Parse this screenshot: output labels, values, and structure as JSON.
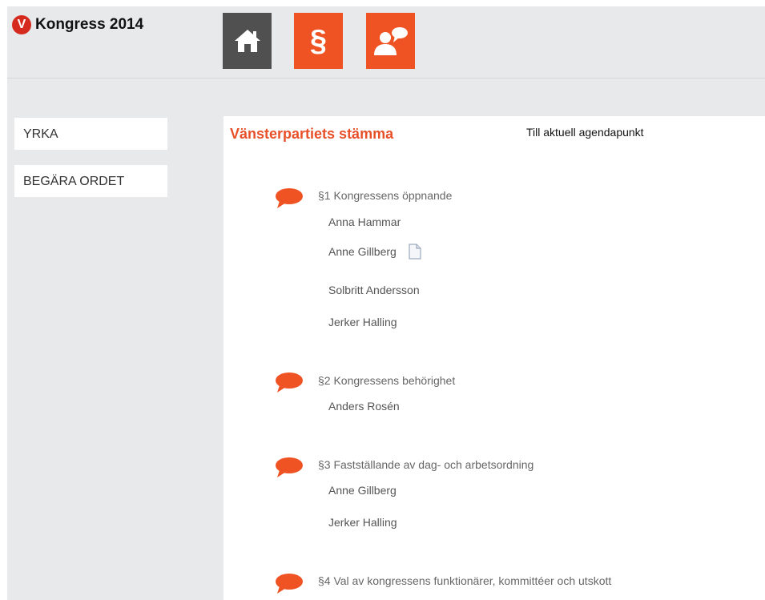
{
  "header": {
    "logo_letter": "V",
    "logo_text": "Kongress 2014",
    "nav": [
      {
        "name": "home-icon"
      },
      {
        "label": "§"
      },
      {
        "name": "speaker-bubble-icon"
      }
    ]
  },
  "sidebar": {
    "items": [
      {
        "label": "YRKA"
      },
      {
        "label": "BEGÄRA ORDET"
      }
    ]
  },
  "main": {
    "title": "Vänsterpartiets stämma",
    "aktuell_link": "Till aktuell agendapunkt",
    "agenda": [
      {
        "title": "§1 Kongressens öppnande",
        "speakers": [
          "Anna Hammar",
          "Anne Gillberg",
          "Solbritt Andersson",
          "Jerker Halling"
        ]
      },
      {
        "title": "§2 Kongressens behörighet",
        "speakers": [
          "Anders Rosén"
        ]
      },
      {
        "title": "§3 Fastställande av dag- och arbetsordning",
        "speakers": [
          "Anne Gillberg",
          "Jerker Halling"
        ]
      },
      {
        "title": "§4 Val av kongressens funktionärer, kommittéer och utskott",
        "speakers": []
      }
    ]
  },
  "colors": {
    "accent": "#f05323",
    "title": "#e8502a",
    "dark_nav": "#505050",
    "panel": "#e8e9eb"
  }
}
